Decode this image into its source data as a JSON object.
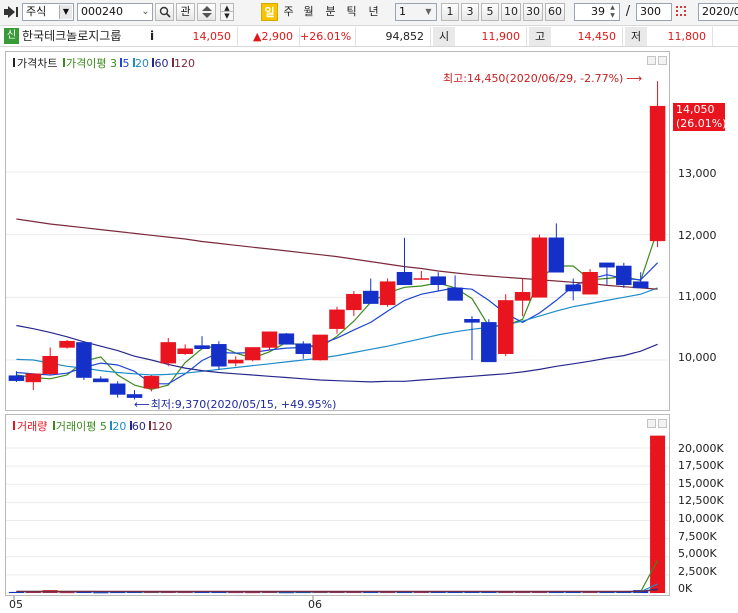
{
  "toolbar": {
    "market_select": "주식",
    "code_input": "000240",
    "interest_btn": "관",
    "period_active": "일",
    "periods": [
      "주",
      "월",
      "분",
      "틱",
      "년"
    ],
    "interval_select": "1",
    "intervals": [
      "1",
      "3",
      "5",
      "10",
      "30",
      "60"
    ],
    "count_value": "39",
    "count_sep": "/",
    "count_total": "300",
    "date_input": "2020/0"
  },
  "info": {
    "badge": "신",
    "name": "한국테크놀로지그룹",
    "info_btn": "i",
    "price": "14,050",
    "change": "▲2,900",
    "change_pct": "+26.01%",
    "volume": "94,852",
    "open_label": "시",
    "open": "11,900",
    "high_label": "고",
    "high": "14,450",
    "low_label": "저",
    "low": "11,800"
  },
  "colors": {
    "up": "#e8141e",
    "down": "#1430c8",
    "ma3": "#3c8a1e",
    "ma5": "#1e46d2",
    "ma20": "#1e8cc8",
    "ma60": "#28288c",
    "ma120": "#7a2a3a"
  },
  "price_panel": {
    "legend": {
      "title": "가격차트",
      "ma_label": "가격이평",
      "periods": [
        "3",
        "5",
        "20",
        "60",
        "120"
      ]
    },
    "annotation_high": "최고:14,450(2020/06/29, -2.77%)",
    "annotation_low": "최저:9,370(2020/05/15, +49.95%)",
    "last_price_tag": "14,050",
    "last_pct_tag": "(26.01%)"
  },
  "volume_panel": {
    "legend": {
      "title": "거래량",
      "ma_label": "거래이평",
      "periods": [
        "5",
        "20",
        "60",
        "120"
      ]
    }
  },
  "x_labels": [
    "05",
    "06"
  ],
  "chart_data": [
    {
      "type": "candlestick",
      "ylim": [
        9250,
        14850
      ],
      "yticks": [
        10000,
        11000,
        12000,
        13000
      ],
      "ytick_labels": [
        "10,000",
        "11,000",
        "12,000",
        "13,000"
      ],
      "ohlc": [
        [
          9750,
          9820,
          9650,
          9670
        ],
        [
          9650,
          9780,
          9520,
          9780
        ],
        [
          9780,
          10200,
          9760,
          10060
        ],
        [
          10200,
          10320,
          10180,
          10300
        ],
        [
          10280,
          10300,
          9680,
          9720
        ],
        [
          9700,
          9740,
          9660,
          9650
        ],
        [
          9620,
          9660,
          9400,
          9450
        ],
        [
          9450,
          9520,
          9370,
          9400
        ],
        [
          9550,
          9760,
          9500,
          9740
        ],
        [
          9950,
          10350,
          9900,
          10280
        ],
        [
          10100,
          10250,
          10080,
          10180
        ],
        [
          10230,
          10380,
          10200,
          10180
        ],
        [
          10250,
          10300,
          9850,
          9900
        ],
        [
          9950,
          10060,
          9900,
          10000
        ],
        [
          10000,
          10200,
          9980,
          10200
        ],
        [
          10200,
          10450,
          10150,
          10450
        ],
        [
          10420,
          10430,
          10250,
          10250
        ],
        [
          10260,
          10300,
          10020,
          10100
        ],
        [
          10000,
          10400,
          9990,
          10400
        ],
        [
          10500,
          10850,
          10420,
          10800
        ],
        [
          10800,
          11100,
          10700,
          11050
        ],
        [
          11100,
          11300,
          10900,
          10900
        ],
        [
          10880,
          11300,
          10850,
          11250
        ],
        [
          11400,
          11950,
          11300,
          11200
        ],
        [
          11300,
          11420,
          11300,
          11300
        ],
        [
          11330,
          11400,
          11100,
          11200
        ],
        [
          11150,
          11350,
          10950,
          10950
        ],
        [
          10650,
          10700,
          10000,
          10600
        ],
        [
          10600,
          10650,
          9970,
          9970
        ],
        [
          10100,
          11050,
          10060,
          10950
        ],
        [
          10950,
          11300,
          10700,
          11080
        ],
        [
          11000,
          12000,
          11000,
          11950
        ],
        [
          11950,
          12180,
          11400,
          11400
        ],
        [
          11200,
          11300,
          10950,
          11100
        ],
        [
          11050,
          11450,
          11050,
          11400
        ],
        [
          11550,
          11200,
          11500,
          11480
        ],
        [
          11500,
          11550,
          11150,
          11200
        ],
        [
          11250,
          11400,
          11150,
          11150
        ],
        [
          11900,
          14450,
          11800,
          14050
        ]
      ],
      "moving_averages": [
        {
          "period": "3",
          "values": [
            9760,
            9720,
            9700,
            9760,
            9980,
            10050,
            9760,
            9600,
            9530,
            9600,
            9960,
            10180,
            10230,
            10110,
            10030,
            10130,
            10280,
            10230,
            10200,
            10380,
            10620,
            10920,
            11070,
            11160,
            11180,
            11230,
            11150,
            10980,
            10540,
            10550,
            10650,
            11300,
            11500,
            11500,
            11280,
            11300,
            11330,
            11270,
            12080
          ]
        },
        {
          "period": "5",
          "values": [
            9800,
            9780,
            9760,
            9790,
            9880,
            9950,
            9920,
            9820,
            9620,
            9620,
            9780,
            9990,
            10120,
            10110,
            10120,
            10160,
            10190,
            10200,
            10250,
            10350,
            10480,
            10600,
            10780,
            10950,
            11050,
            11100,
            11150,
            11130,
            10950,
            10740,
            10600,
            10750,
            10950,
            11180,
            11290,
            11360,
            11300,
            11280,
            11550
          ]
        },
        {
          "period": "20",
          "values": [
            10010,
            10000,
            9950,
            9900,
            9870,
            9830,
            9800,
            9780,
            9760,
            9770,
            9790,
            9820,
            9850,
            9880,
            9910,
            9940,
            9970,
            10000,
            10030,
            10070,
            10120,
            10170,
            10220,
            10280,
            10340,
            10400,
            10450,
            10490,
            10520,
            10560,
            10620,
            10700,
            10780,
            10850,
            10900,
            10950,
            11000,
            11050,
            11150
          ]
        },
        {
          "period": "60",
          "values": [
            10550,
            10500,
            10440,
            10370,
            10290,
            10220,
            10150,
            10060,
            10000,
            9930,
            9870,
            9830,
            9800,
            9780,
            9760,
            9740,
            9720,
            9700,
            9680,
            9670,
            9660,
            9650,
            9660,
            9660,
            9680,
            9700,
            9720,
            9740,
            9760,
            9780,
            9810,
            9850,
            9900,
            9940,
            9980,
            10030,
            10070,
            10140,
            10250
          ]
        },
        {
          "period": "120",
          "values": [
            12250,
            12210,
            12170,
            12140,
            12110,
            12080,
            12050,
            12020,
            11990,
            11960,
            11930,
            11890,
            11860,
            11830,
            11800,
            11770,
            11740,
            11710,
            11680,
            11650,
            11610,
            11570,
            11530,
            11490,
            11460,
            11420,
            11390,
            11360,
            11340,
            11320,
            11300,
            11280,
            11260,
            11240,
            11220,
            11190,
            11170,
            11150,
            11130
          ]
        }
      ]
    },
    {
      "type": "bar",
      "ylim": [
        0,
        22200
      ],
      "yticks": [
        0,
        2500,
        5000,
        7500,
        10000,
        12500,
        15000,
        17500,
        20000
      ],
      "ytick_labels": [
        "0K",
        "2,500K",
        "5,000K",
        "7,500K",
        "10,000K",
        "12,500K",
        "15,000K",
        "17,500K",
        "20,000K"
      ],
      "values": [
        150,
        160,
        400,
        120,
        180,
        100,
        130,
        150,
        160,
        190,
        210,
        180,
        170,
        130,
        120,
        140,
        110,
        130,
        160,
        200,
        150,
        170,
        160,
        150,
        140,
        150,
        160,
        180,
        140,
        200,
        170,
        190,
        160,
        140,
        170,
        150,
        160,
        400,
        21700
      ],
      "moving_averages": [
        {
          "period": "5",
          "values": [
            200,
            200,
            210,
            200,
            200,
            190,
            180,
            150,
            140,
            150,
            170,
            180,
            180,
            170,
            160,
            150,
            140,
            140,
            140,
            150,
            150,
            160,
            170,
            170,
            160,
            150,
            150,
            160,
            150,
            160,
            170,
            180,
            170,
            170,
            170,
            160,
            160,
            200,
            4500
          ]
        },
        {
          "period": "20",
          "values": [
            180,
            180,
            180,
            180,
            180,
            180,
            180,
            170,
            170,
            170,
            170,
            170,
            170,
            170,
            170,
            160,
            160,
            160,
            160,
            160,
            160,
            160,
            160,
            160,
            160,
            160,
            160,
            160,
            160,
            160,
            160,
            160,
            160,
            160,
            160,
            160,
            160,
            180,
            1250
          ]
        },
        {
          "period": "60",
          "values": [
            190,
            190,
            190,
            190,
            190,
            190,
            190,
            190,
            190,
            190,
            190,
            190,
            190,
            190,
            190,
            190,
            190,
            190,
            190,
            190,
            190,
            190,
            190,
            190,
            190,
            190,
            190,
            190,
            190,
            190,
            190,
            190,
            190,
            190,
            190,
            190,
            190,
            200,
            550
          ]
        },
        {
          "period": "120",
          "values": [
            230,
            230,
            230,
            230,
            230,
            230,
            230,
            230,
            230,
            230,
            230,
            230,
            230,
            230,
            230,
            230,
            230,
            230,
            230,
            230,
            230,
            230,
            230,
            230,
            230,
            230,
            230,
            230,
            230,
            230,
            230,
            230,
            230,
            230,
            230,
            230,
            230,
            230,
            400
          ]
        }
      ]
    }
  ]
}
